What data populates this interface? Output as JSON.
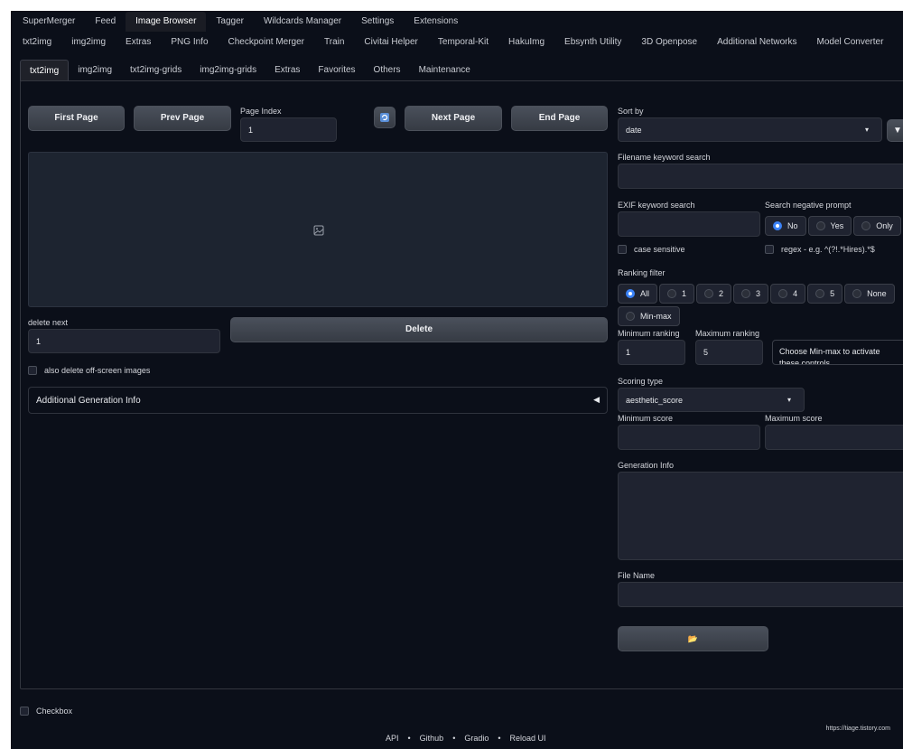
{
  "top_tabs": [
    "SuperMerger",
    "Feed",
    "Image Browser",
    "Tagger",
    "Wildcards Manager",
    "Settings",
    "Extensions"
  ],
  "top_tabs_active": "Image Browser",
  "sub_tabs": [
    "txt2img",
    "img2img",
    "Extras",
    "PNG Info",
    "Checkpoint Merger",
    "Train",
    "Civitai Helper",
    "Temporal-Kit",
    "HakuImg",
    "Ebsynth Utility",
    "3D Openpose",
    "Additional Networks",
    "Model Converter"
  ],
  "browser_tabs": [
    "txt2img",
    "img2img",
    "txt2img-grids",
    "img2img-grids",
    "Extras",
    "Favorites",
    "Others",
    "Maintenance"
  ],
  "browser_tabs_active": "txt2img",
  "nav": {
    "first_page": "First Page",
    "prev_page": "Prev Page",
    "page_index_label": "Page Index",
    "page_index_value": "1",
    "next_page": "Next Page",
    "end_page": "End Page"
  },
  "delete": {
    "delete_next_label": "delete next",
    "delete_next_value": "1",
    "delete_button": "Delete",
    "also_delete_label": "also delete off-screen images"
  },
  "additional_info": "Additional Generation Info",
  "sort": {
    "label": "Sort by",
    "value": "date"
  },
  "filename_search_label": "Filename keyword search",
  "exif_search_label": "EXIF keyword search",
  "search_negative": {
    "label": "Search negative prompt",
    "options": [
      "No",
      "Yes",
      "Only"
    ],
    "selected": "No"
  },
  "case_sensitive": "case sensitive",
  "regex_label": "regex - e.g. ^(?!.*Hires).*$",
  "ranking_filter": {
    "label": "Ranking filter",
    "options": [
      "All",
      "1",
      "2",
      "3",
      "4",
      "5",
      "None"
    ],
    "extra_option": "Min-max",
    "selected": "All"
  },
  "min_ranking": {
    "label": "Minimum ranking",
    "value": "1"
  },
  "max_ranking": {
    "label": "Maximum ranking",
    "value": "5"
  },
  "minmax_note": "Choose Min-max to activate these controls",
  "scoring": {
    "label": "Scoring type",
    "value": "aesthetic_score"
  },
  "min_score_label": "Minimum score",
  "max_score_label": "Maximum score",
  "generation_info_label": "Generation Info",
  "file_name_label": "File Name",
  "bottom_checkbox": "Checkbox",
  "footer": {
    "api": "API",
    "github": "Github",
    "gradio": "Gradio",
    "reload": "Reload UI",
    "sep": "•"
  },
  "watermark": "https://tiage.tistory.com"
}
